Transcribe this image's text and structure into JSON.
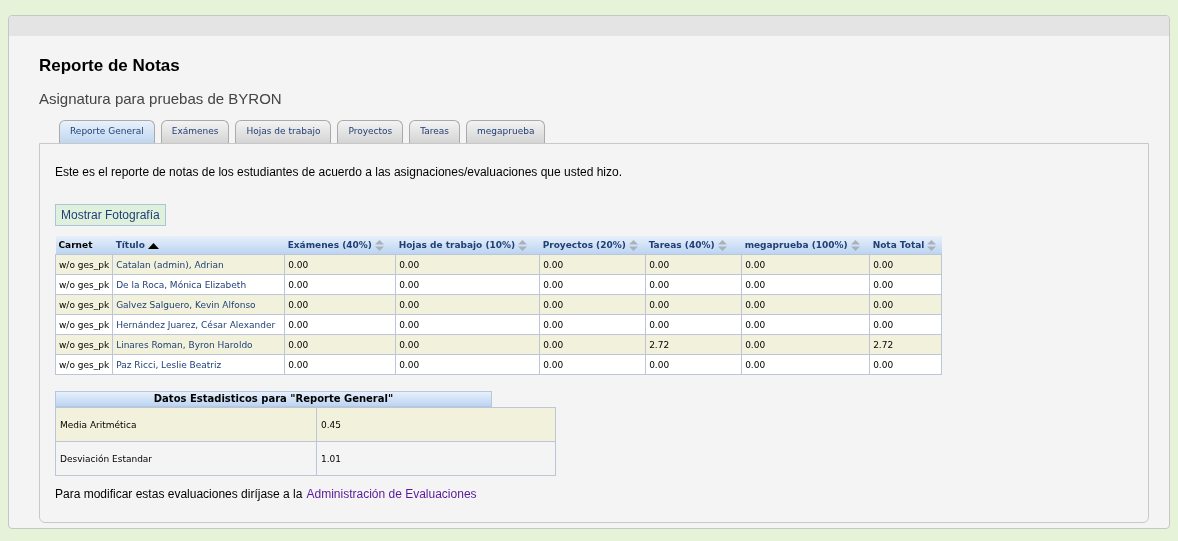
{
  "page": {
    "title": "Reporte de Notas",
    "subtitle": "Asignatura para pruebas de BYRON"
  },
  "tabs": [
    {
      "label": "Reporte General",
      "selected": true
    },
    {
      "label": "Exámenes",
      "selected": false
    },
    {
      "label": "Hojas de trabajo",
      "selected": false
    },
    {
      "label": "Proyectos",
      "selected": false
    },
    {
      "label": "Tareas",
      "selected": false
    },
    {
      "label": "megaprueba",
      "selected": false
    }
  ],
  "intro": "Este es el reporte de notas de los estudiantes de acuerdo a las asignaciones/evaluaciones que usted hizo.",
  "photo_button": "Mostrar Fotografía",
  "table": {
    "columns": [
      {
        "label": "Carnet",
        "sortable": false,
        "sorted": false
      },
      {
        "label": "Título",
        "sortable": true,
        "sorted": true
      },
      {
        "label": "Exámenes (40%)",
        "sortable": true,
        "sorted": false
      },
      {
        "label": "Hojas de trabajo (10%)",
        "sortable": true,
        "sorted": false
      },
      {
        "label": "Proyectos (20%)",
        "sortable": true,
        "sorted": false
      },
      {
        "label": "Tareas (40%)",
        "sortable": true,
        "sorted": false
      },
      {
        "label": "megaprueba (100%)",
        "sortable": true,
        "sorted": false
      },
      {
        "label": "Nota Total",
        "sortable": true,
        "sorted": false
      }
    ],
    "rows": [
      [
        "w/o ges_pk",
        "Catalan (admin), Adrian",
        "0.00",
        "0.00",
        "0.00",
        "0.00",
        "0.00",
        "0.00"
      ],
      [
        "w/o ges_pk",
        "De la Roca, Mónica Elizabeth",
        "0.00",
        "0.00",
        "0.00",
        "0.00",
        "0.00",
        "0.00"
      ],
      [
        "w/o ges_pk",
        "Galvez Salguero, Kevin Alfonso",
        "0.00",
        "0.00",
        "0.00",
        "0.00",
        "0.00",
        "0.00"
      ],
      [
        "w/o ges_pk",
        "Hernández Juarez, César Alexander",
        "0.00",
        "0.00",
        "0.00",
        "0.00",
        "0.00",
        "0.00"
      ],
      [
        "w/o ges_pk",
        "Linares Roman, Byron Haroldo",
        "0.00",
        "0.00",
        "0.00",
        "2.72",
        "0.00",
        "2.72"
      ],
      [
        "w/o ges_pk",
        "Paz Ricci, Leslie Beatriz",
        "0.00",
        "0.00",
        "0.00",
        "0.00",
        "0.00",
        "0.00"
      ]
    ]
  },
  "stats": {
    "title": "Datos Estadisticos para \"Reporte General\"",
    "rows": [
      {
        "label": "Media Aritmética",
        "value": "0.45"
      },
      {
        "label": "Desviación Estandar",
        "value": "1.01"
      }
    ]
  },
  "footer": {
    "text": "Para modificar estas evaluaciones diríjase a la",
    "link": "Administración de Evaluaciones"
  }
}
